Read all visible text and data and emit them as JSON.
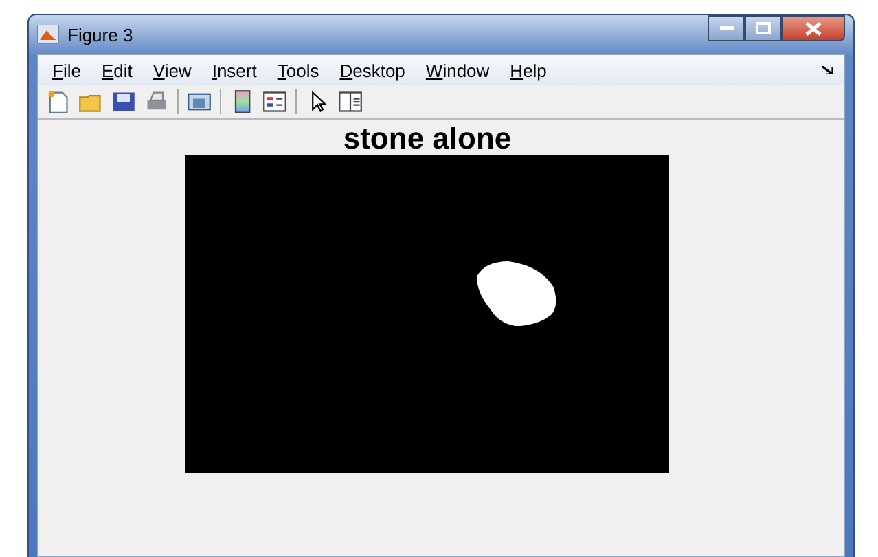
{
  "window": {
    "title": "Figure 3"
  },
  "menu": [
    "File",
    "Edit",
    "View",
    "Insert",
    "Tools",
    "Desktop",
    "Window",
    "Help"
  ],
  "figure": {
    "title": "stone alone"
  }
}
